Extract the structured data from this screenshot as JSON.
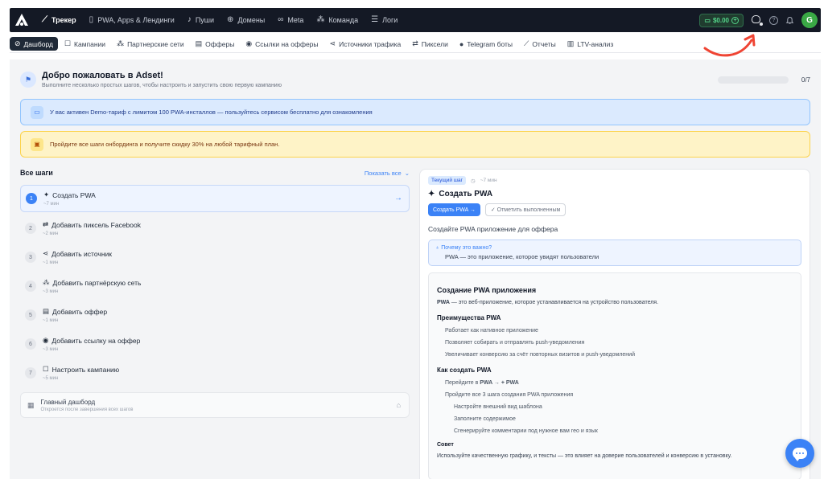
{
  "topbar": {
    "nav": [
      {
        "label": "Трекер",
        "icon": "chart-line-icon",
        "glyph": "⟋",
        "active": true
      },
      {
        "label": "PWA, Apps & Лендинги",
        "icon": "document-icon",
        "glyph": "▯",
        "active": false
      },
      {
        "label": "Пуши",
        "icon": "bell-icon",
        "glyph": "♪",
        "active": false
      },
      {
        "label": "Домены",
        "icon": "globe-icon",
        "glyph": "⊕",
        "active": false
      },
      {
        "label": "Meta",
        "icon": "meta-icon",
        "glyph": "∞",
        "active": false
      },
      {
        "label": "Команда",
        "icon": "team-icon",
        "glyph": "⁂",
        "active": false
      },
      {
        "label": "Логи",
        "icon": "list-icon",
        "glyph": "☰",
        "active": false
      }
    ],
    "balance": "$0.00",
    "avatar_letter": "G"
  },
  "subnav": [
    {
      "label": "Дашборд",
      "icon": "dashboard-icon",
      "glyph": "⊘",
      "active": true
    },
    {
      "label": "Кампании",
      "icon": "edit-icon",
      "glyph": "☐",
      "active": false
    },
    {
      "label": "Партнерские сети",
      "icon": "team-icon",
      "glyph": "⁂",
      "active": false
    },
    {
      "label": "Офферы",
      "icon": "offer-icon",
      "glyph": "▤",
      "active": false
    },
    {
      "label": "Ссылки на офферы",
      "icon": "link-pin-icon",
      "glyph": "◉",
      "active": false
    },
    {
      "label": "Источники трафика",
      "icon": "share-icon",
      "glyph": "⋖",
      "active": false
    },
    {
      "label": "Пиксели",
      "icon": "swap-icon",
      "glyph": "⇄",
      "active": false
    },
    {
      "label": "Telegram боты",
      "icon": "telegram-icon",
      "glyph": "●",
      "active": false
    },
    {
      "label": "Отчеты",
      "icon": "report-icon",
      "glyph": "⟋",
      "active": false
    },
    {
      "label": "LTV-анализ",
      "icon": "bar-chart-icon",
      "glyph": "▥",
      "active": false
    }
  ],
  "welcome": {
    "title": "Добро пожаловать в Adset!",
    "subtitle": "Выполните несколько простых шагов, чтобы настроить и запустить свою первую кампанию",
    "progress_text": "0/7",
    "progress_fraction": 0
  },
  "banners": {
    "demo": "У вас активен Demo-тариф с лимитом 100 PWA-инсталлов — пользуйтесь сервисом бесплатно для ознакомления",
    "discount": "Пройдите все шаги онбординга и получите скидку 30% на любой тарифный план."
  },
  "steps_panel": {
    "title": "Все шаги",
    "show_all": "Показать все",
    "steps": [
      {
        "num": "1",
        "title": "Создать PWA",
        "time": "~7 мин",
        "icon": "android-icon",
        "glyph": "✦",
        "active": true
      },
      {
        "num": "2",
        "title": "Добавить пиксель Facebook",
        "time": "~2 мин",
        "icon": "swap-icon",
        "glyph": "⇄",
        "active": false
      },
      {
        "num": "3",
        "title": "Добавить источник",
        "time": "~1 мин",
        "icon": "share-icon",
        "glyph": "⋖",
        "active": false
      },
      {
        "num": "4",
        "title": "Добавить партнёрскую сеть",
        "time": "~3 мин",
        "icon": "team-icon",
        "glyph": "⁂",
        "active": false
      },
      {
        "num": "5",
        "title": "Добавить оффер",
        "time": "~1 мин",
        "icon": "offer-icon",
        "glyph": "▤",
        "active": false
      },
      {
        "num": "6",
        "title": "Добавить ссылку на оффер",
        "time": "~3 мин",
        "icon": "link-pin-icon",
        "glyph": "◉",
        "active": false
      },
      {
        "num": "7",
        "title": "Настроить кампанию",
        "time": "~5 мин",
        "icon": "edit-icon",
        "glyph": "☐",
        "active": false
      }
    ],
    "dashboard": {
      "title": "Главный дашборд",
      "subtitle": "Откроется после завершения всех шагов"
    }
  },
  "current_step": {
    "badge": "Текущий шаг",
    "time": "~7 мин",
    "title": "Создать PWA",
    "create_button": "Создать PWA",
    "mark_done_button": "Отметить выполненным",
    "description": "Создайте PWA приложение для оффера",
    "why_question": "Почему это важно?",
    "why_answer": "PWA — это приложение, которое увидят пользователи",
    "doc": {
      "h1": "Создание PWA приложения",
      "intro_bold": "PWA",
      "intro_rest": " — это веб-приложение, которое устанавливается на устройство пользователя.",
      "benefits_title": "Преимущества PWA",
      "benefits": [
        "Работает как нативное приложение",
        "Позволяет собирать и отправлять push-уведомления",
        "Увеличивает конверсию за счёт повторных визитов и push-уведомлений"
      ],
      "howto_title": "Как создать PWA",
      "howto_step1_pre": "Перейдите в ",
      "howto_step1_bold": "PWA → + PWA",
      "howto_step2": "Пройдите все 3 шага создания PWA приложения",
      "substeps": [
        "Настройте внешний вид шаблона",
        "Заполните содержимое",
        "Сгенерируйте комментарии под нужное вам гео и язык"
      ],
      "tip_title": "Совет",
      "tip": "Используйте качественную графику, и тексты — это влияет на доверие пользователей и конверсию в установку."
    }
  },
  "colors": {
    "topbar": "#141925",
    "accent": "#3b82f6",
    "annotation_arrow": "#ef4433",
    "avatar": "#3aa845"
  }
}
